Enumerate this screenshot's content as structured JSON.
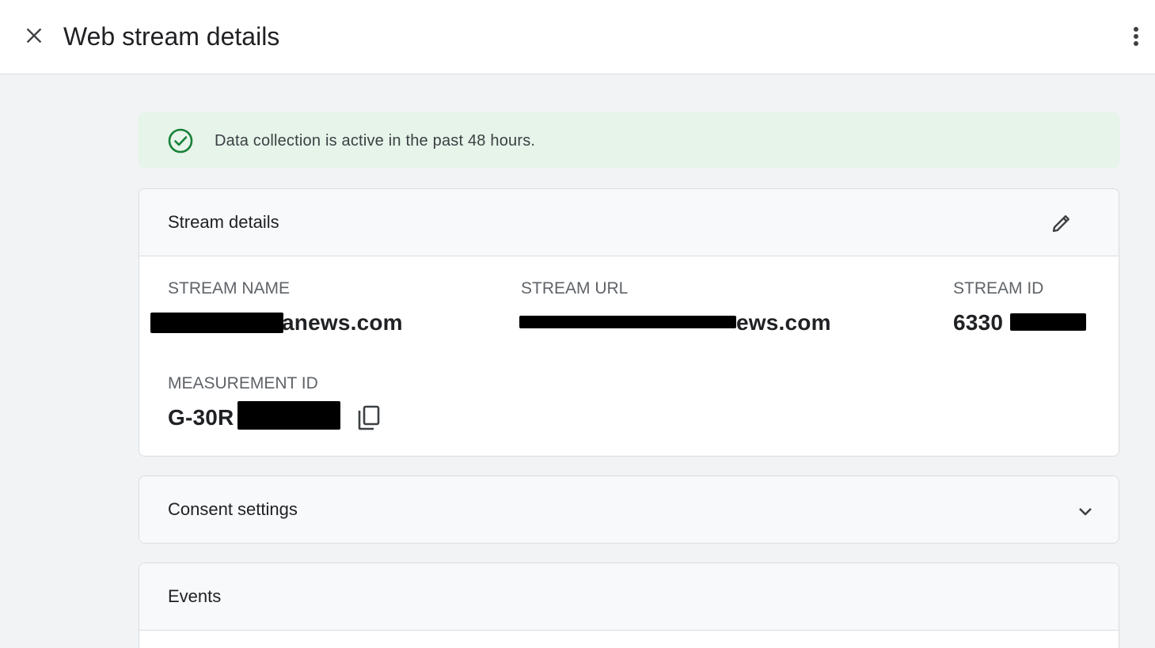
{
  "header": {
    "title": "Web stream details",
    "close_icon": "close-icon",
    "menu_icon": "more-vert-icon"
  },
  "banner": {
    "text": "Data collection is active in the past 48 hours.",
    "icon": "check-circle-icon",
    "color": "#188038",
    "background": "#e6f4ea"
  },
  "stream_details": {
    "title": "Stream details",
    "edit_icon": "pencil-icon",
    "fields": {
      "stream_name": {
        "label": "STREAM NAME",
        "value_visible": "anews.com"
      },
      "stream_url": {
        "label": "STREAM URL",
        "value_visible": "ews.com"
      },
      "stream_id": {
        "label": "STREAM ID",
        "value_visible": "6330"
      },
      "measurement_id": {
        "label": "MEASUREMENT ID",
        "value_visible": "G-30R",
        "copy_icon": "copy-icon"
      }
    }
  },
  "consent": {
    "title": "Consent settings",
    "chevron_icon": "chevron-down-icon"
  },
  "events": {
    "title": "Events"
  }
}
